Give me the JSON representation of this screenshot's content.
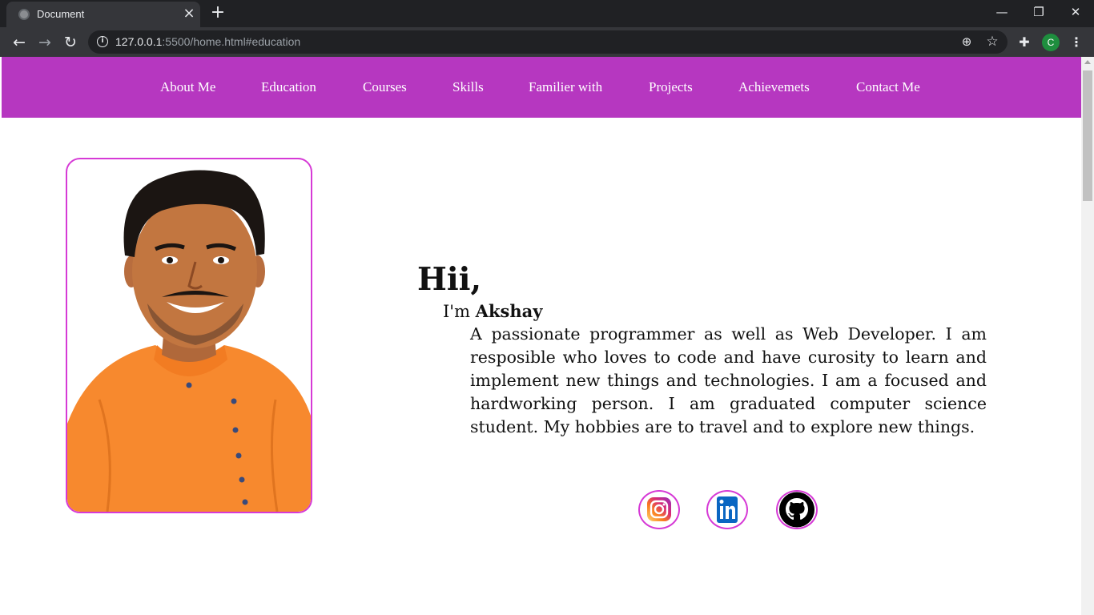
{
  "browser": {
    "tab_title": "Document",
    "url_host": "127.0.0.1",
    "url_rest": ":5500/home.html#education",
    "profile_initial": "C"
  },
  "nav": {
    "items": [
      "About Me",
      "Education",
      "Courses",
      "Skills",
      "Familier with",
      "Projects",
      "Achievemets",
      "Contact Me"
    ]
  },
  "hero": {
    "greeting": "Hii,",
    "intro_prefix": "I'm ",
    "name": "Akshay",
    "bio": "A passionate programmer as well as Web Developer. I am resposible who loves to code and have curosity to learn and implement new things and technologies. I am a focused and hardworking person. I am graduated computer science student. My hobbies are to travel and to explore new things."
  },
  "social": [
    "instagram-icon",
    "linkedin-icon",
    "github-icon"
  ],
  "colors": {
    "nav_bg": "#b637c0",
    "accent_border": "#d63ad6",
    "shirt": "#f7892e"
  }
}
